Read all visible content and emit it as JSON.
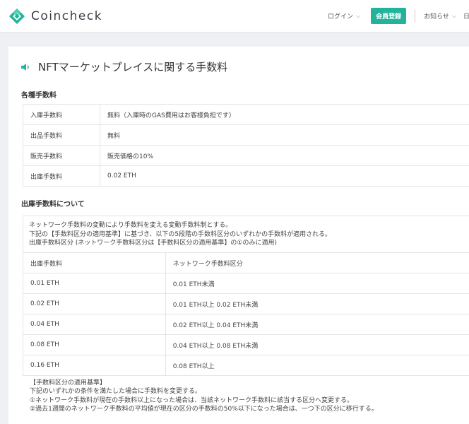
{
  "header": {
    "logo_text": "Coincheck",
    "nav": {
      "login": "ログイン",
      "signup": "会員登録",
      "news": "お知らせ",
      "lang": "日本語"
    }
  },
  "colors": {
    "brand": "#23b39a",
    "brand_dark": "#1a9f8a"
  },
  "page": {
    "title": "NFTマーケットプレイスに関する手数料",
    "fees_section": {
      "title": "各種手数料",
      "rows": [
        {
          "label": "入庫手数料",
          "value": "無料（入庫時のGAS費用はお客様負担です）"
        },
        {
          "label": "出品手数料",
          "value": "無料"
        },
        {
          "label": "販売手数料",
          "value": "販売価格の10%"
        },
        {
          "label": "出庫手数料",
          "value": "0.02 ETH"
        }
      ]
    },
    "withdrawal_section": {
      "title": "出庫手数料について",
      "notes": [
        "ネットワーク手数料の変動により手数料を変える変動手数料制とする。",
        "下記の【手数料区分の適用基準】に基づき、以下の5段階の手数料区分のいずれかの手数料が適用される。",
        "出庫手数料区分 (ネットワーク手数料区分は【手数料区分の適用基準】の①のみに適用)"
      ],
      "table": {
        "headers": [
          "出庫手数料",
          "ネットワーク手数料区分"
        ],
        "rows": [
          [
            "0.01 ETH",
            "0.01 ETH未満"
          ],
          [
            "0.02 ETH",
            "0.01 ETH以上 0.02 ETH未満"
          ],
          [
            "0.04 ETH",
            "0.02 ETH以上 0.04 ETH未満"
          ],
          [
            "0.08 ETH",
            "0.04 ETH以上 0.08 ETH未満"
          ],
          [
            "0.16 ETH",
            "0.08 ETH以上"
          ]
        ]
      },
      "rules": {
        "title": "【手数料区分の適用基準】",
        "lines": [
          "下記のいずれかの条件を満たした場合に手数料を変更する。",
          "①ネットワーク手数料が現在の手数料以上になった場合は、当該ネットワーク手数料に該当する区分へ変更する。",
          "②過去1週間のネットワーク手数料の平均値が現在の区分の手数料の50%以下になった場合は、一つ下の区分に移行する。"
        ]
      }
    }
  }
}
